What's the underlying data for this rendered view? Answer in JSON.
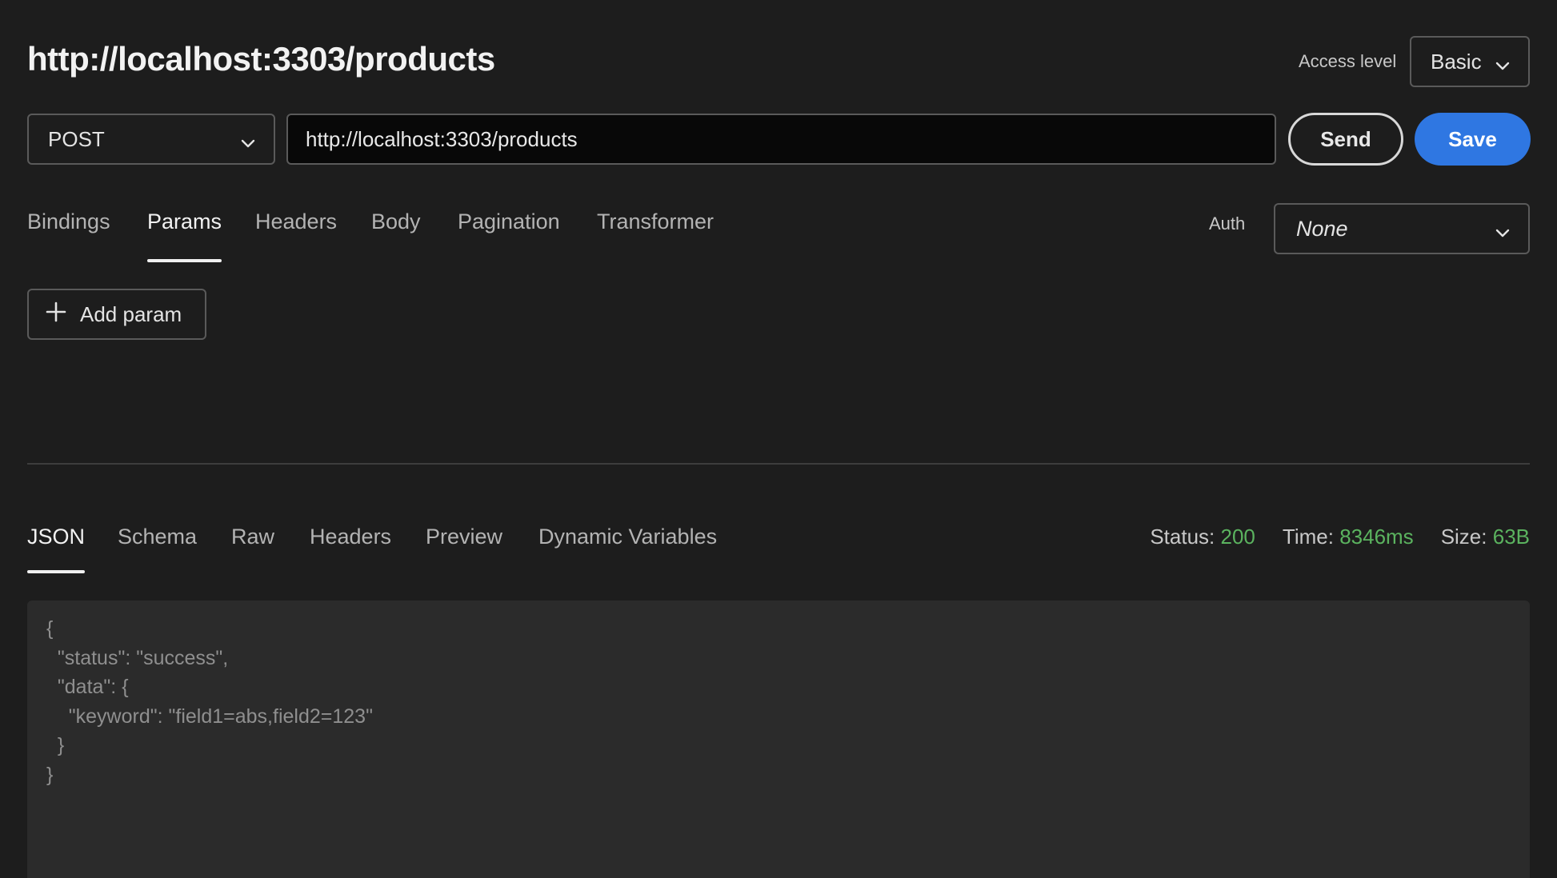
{
  "header": {
    "title": "http://localhost:3303/products",
    "access_label": "Access level",
    "access_value": "Basic"
  },
  "request": {
    "method": "POST",
    "url": "http://localhost:3303/products",
    "send_label": "Send",
    "save_label": "Save"
  },
  "request_tabs": [
    {
      "label": "Bindings",
      "active": false
    },
    {
      "label": "Params",
      "active": true
    },
    {
      "label": "Headers",
      "active": false
    },
    {
      "label": "Body",
      "active": false
    },
    {
      "label": "Pagination",
      "active": false
    },
    {
      "label": "Transformer",
      "active": false
    }
  ],
  "auth": {
    "label": "Auth",
    "value": "None"
  },
  "params": {
    "add_label": "Add param"
  },
  "response_tabs": [
    {
      "label": "JSON",
      "active": true
    },
    {
      "label": "Schema",
      "active": false
    },
    {
      "label": "Raw",
      "active": false
    },
    {
      "label": "Headers",
      "active": false
    },
    {
      "label": "Preview",
      "active": false
    },
    {
      "label": "Dynamic Variables",
      "active": false
    }
  ],
  "stats": {
    "status_label": "Status:",
    "status_value": "200",
    "time_label": "Time:",
    "time_value": "8346ms",
    "size_label": "Size:",
    "size_value": "63B"
  },
  "response_json": [
    "{",
    "  \"status\": \"success\",",
    "  \"data\": {",
    "    \"keyword\": \"field1=abs,field2=123\"",
    "  }",
    "}"
  ],
  "colors": {
    "background": "#1d1d1d",
    "accent": "#2f77e2",
    "success": "#5bb35f",
    "panel": "#2b2b2b"
  }
}
